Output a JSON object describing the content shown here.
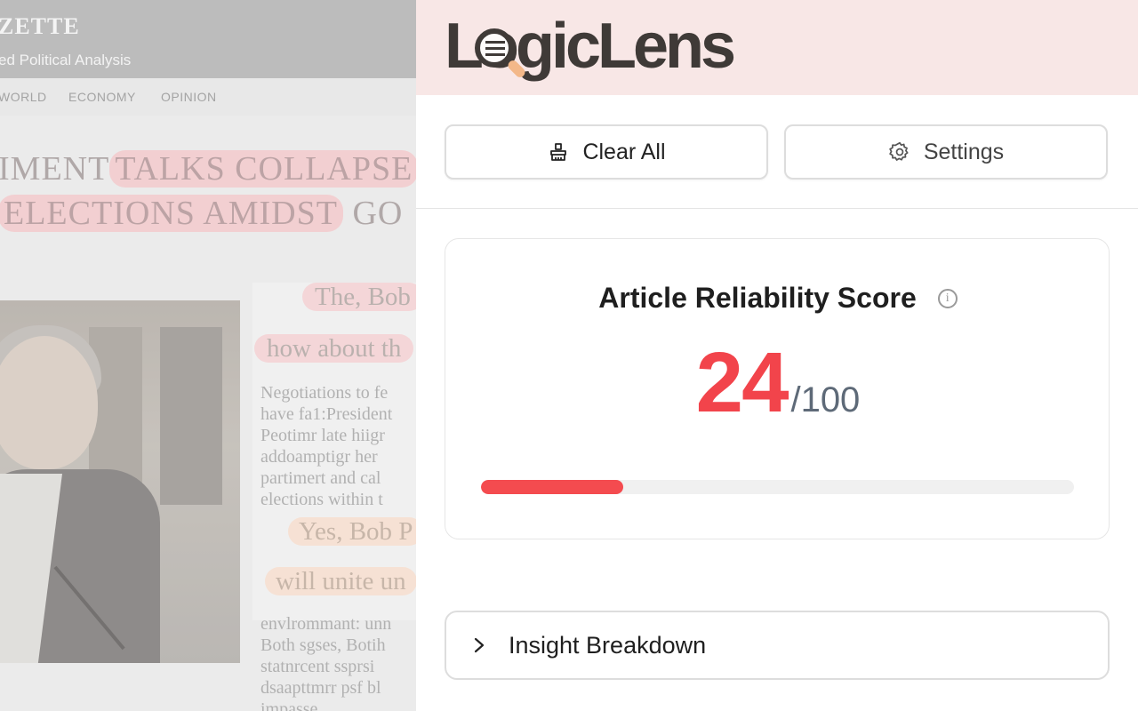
{
  "article": {
    "brand": "ZETTE",
    "tagline": "ed Political Analysis",
    "nav": [
      "WORLD",
      "ECONOMY",
      "OPINION"
    ],
    "headline_line1_plain": "IMENT",
    "headline_line1_flagged": "TALKS COLLAPSE",
    "headline_line2_flagged": "ELECTIONS AMIDST",
    "headline_line2_plain": "GO",
    "quote1": "The, Bob",
    "quote2": "how about th",
    "paragraph1": [
      "Negotiations to fe",
      "have fa1:President",
      "Peotimr late hiigr",
      "addoamptigr her",
      "partimert and cal",
      "elections within t"
    ],
    "quote3": "Yes, Bob P",
    "quote4": "will unite un",
    "paragraph2": [
      "envlrommant: unn",
      "Both sgses, Botih",
      "statnrcent ssprsi",
      "dsaapttmrr psf bl",
      "impasse"
    ]
  },
  "panel": {
    "app_name": "LogicLens",
    "toolbar": {
      "clear_label": "Clear All",
      "settings_label": "Settings"
    },
    "score_card": {
      "title": "Article Reliability Score",
      "score": "24",
      "score_max": "/100",
      "score_fraction": 0.24,
      "score_color": "#f2444b"
    },
    "insight": {
      "label": "Insight Breakdown"
    }
  },
  "icons": {
    "clear": "broom-icon",
    "settings": "gear-icon",
    "info": "info-icon",
    "chevron": "chevron-right-icon"
  },
  "colors": {
    "header_bg": "#f8e7e6",
    "accent_red": "#f44b4f",
    "muted_text": "#5e6a78"
  }
}
